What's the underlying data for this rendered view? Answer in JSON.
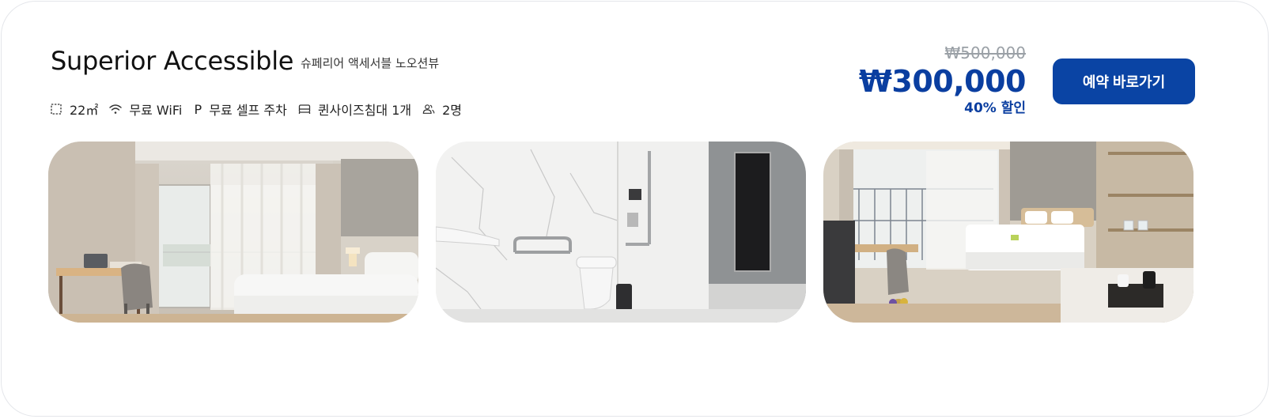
{
  "room": {
    "title": "Superior Accessible",
    "subtitle": "슈페리어 액세서블 노오션뷰"
  },
  "amenities": [
    {
      "icon": "room-size-icon",
      "label": "22㎡"
    },
    {
      "icon": "wifi-icon",
      "label": "무료 WiFi"
    },
    {
      "icon": "parking-icon",
      "label": "무료 셀프 주차"
    },
    {
      "icon": "bed-icon",
      "label": "퀸사이즈침대 1개"
    },
    {
      "icon": "guests-icon",
      "label": "2명"
    }
  ],
  "price": {
    "original": "₩500,000",
    "current": "₩300,000",
    "discount": "40% 할인"
  },
  "book_button": {
    "label": "예약 바로가기"
  },
  "photos": [
    {
      "subject": "bedroom-window"
    },
    {
      "subject": "accessible-bathroom"
    },
    {
      "subject": "bedroom-overview"
    }
  ],
  "colors": {
    "accent": "#0a44a4",
    "price": "#0a3ea0",
    "strike_price": "#9aa0a6"
  }
}
